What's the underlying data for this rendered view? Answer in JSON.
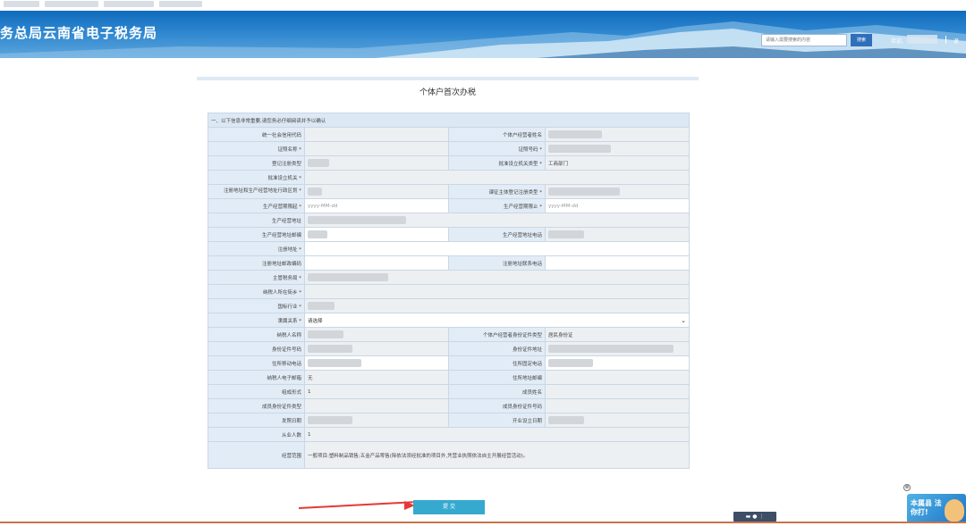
{
  "header": {
    "site_title": "务总局云南省电子税务局",
    "search_placeholder": "请输入需要搜索的内容",
    "search_button": "搜索",
    "welcome": "欢迎,",
    "logout": "退"
  },
  "page": {
    "title": "个体户首次办税",
    "section_note": "一、以下信息非常重要,请您务必仔细阅读并予以确认",
    "submit_label": "提 交"
  },
  "form": {
    "credit_code_label": "统一社会信用代码",
    "operator_name_label": "个体户经营者姓名",
    "cert_name_label": "证照名称 *",
    "cert_no_label": "证照号码 *",
    "reg_type_label": "登记注册类型",
    "approver_type_label": "批准设立机关类型 *",
    "approver_type_value": "工商部门",
    "approver_label": "批准设立机关 *",
    "district_label": "注册地址和生产经营地址行政区划 *",
    "main_reg_type_label": "课征主体登记注册类型 *",
    "period_start_label": "生产经营期限起 *",
    "period_start_placeholder": "yyyy-MM-dd",
    "period_end_label": "生产经营期限止 *",
    "period_end_placeholder": "yyyy-MM-dd",
    "biz_addr_label": "生产经营地址",
    "biz_post_label": "生产经营地址邮编",
    "biz_phone_label": "生产经营地址电话",
    "reg_addr_label": "注册地址 *",
    "reg_post_label": "注册地址邮政编码",
    "reg_phone_label": "注册地址联系电话",
    "tax_office_label": "主管税务局 *",
    "street_label": "纳税人所在街乡 *",
    "industry_label": "国标行业 *",
    "affiliation_label": "隶属关系 *",
    "affiliation_value": "请选择",
    "taxpayer_name_label": "纳税人名称",
    "id_type_label": "个体户经营者身份证件类型",
    "id_type_value": "居民身份证",
    "id_no_label": "身份证件号码",
    "id_addr_label": "身份证件地址",
    "home_mobile_label": "住所移动电话",
    "home_phone_label": "住所固定电话",
    "email_label": "纳税人电子邮箱",
    "email_value": "无",
    "home_post_label": "住所地址邮编",
    "form_label": "组成形式",
    "form_value": "1",
    "member_name_label": "成员姓名",
    "member_id_type_label": "成员身份证件类型",
    "member_id_no_label": "成员身份证件号码",
    "issue_date_label": "发照日期",
    "open_date_label": "开业设立日期",
    "employees_label": "从业人数",
    "employees_value": "1",
    "scope_label": "经营范围",
    "scope_value": "一般项目:塑料制品销售;五金产品零售(除依法须经批准的项目外,凭营业执照依法自主开展经营活动)。"
  },
  "widgets": {
    "ad_text": "本属县 法你打!",
    "close_glyph": "⊗"
  }
}
